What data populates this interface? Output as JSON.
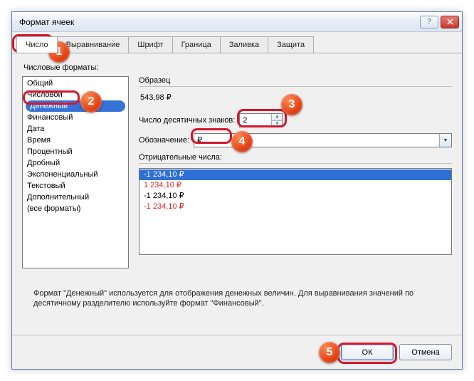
{
  "title": "Формат ячеек",
  "tabs": [
    "Число",
    "Выравнивание",
    "Шрифт",
    "Граница",
    "Заливка",
    "Защита"
  ],
  "tabs_selected_index": 0,
  "formats_label": "Числовые форматы:",
  "formats": [
    "Общий",
    "Числовой",
    "Денежный",
    "Финансовый",
    "Дата",
    "Время",
    "Процентный",
    "Дробный",
    "Экспоненциальный",
    "Текстовый",
    "Дополнительный",
    "(все форматы)"
  ],
  "formats_selected_index": 2,
  "sample_label": "Образец",
  "sample_value": "543,98 ₽",
  "decimal_label": "Число десятичных знаков:",
  "decimal_value": "2",
  "symbol_label": "Обозначение:",
  "symbol_value": "₽",
  "neg_label": "Отрицательные числа:",
  "neg_items": [
    {
      "text": "-1 234,10 ₽",
      "red": false,
      "selected": true
    },
    {
      "text": "1 234,10 ₽",
      "red": true,
      "selected": false
    },
    {
      "text": "-1 234,10 ₽",
      "red": false,
      "selected": false
    },
    {
      "text": "-1 234,10 ₽",
      "red": true,
      "selected": false
    }
  ],
  "description": "Формат \"Денежный\" используется для отображения денежных величин. Для выравнивания значений по десятичному разделителю используйте формат \"Финансовый\".",
  "buttons": {
    "ok": "ОК",
    "cancel": "Отмена"
  },
  "callouts": {
    "1": "1",
    "2": "2",
    "3": "3",
    "4": "4",
    "5": "5"
  }
}
